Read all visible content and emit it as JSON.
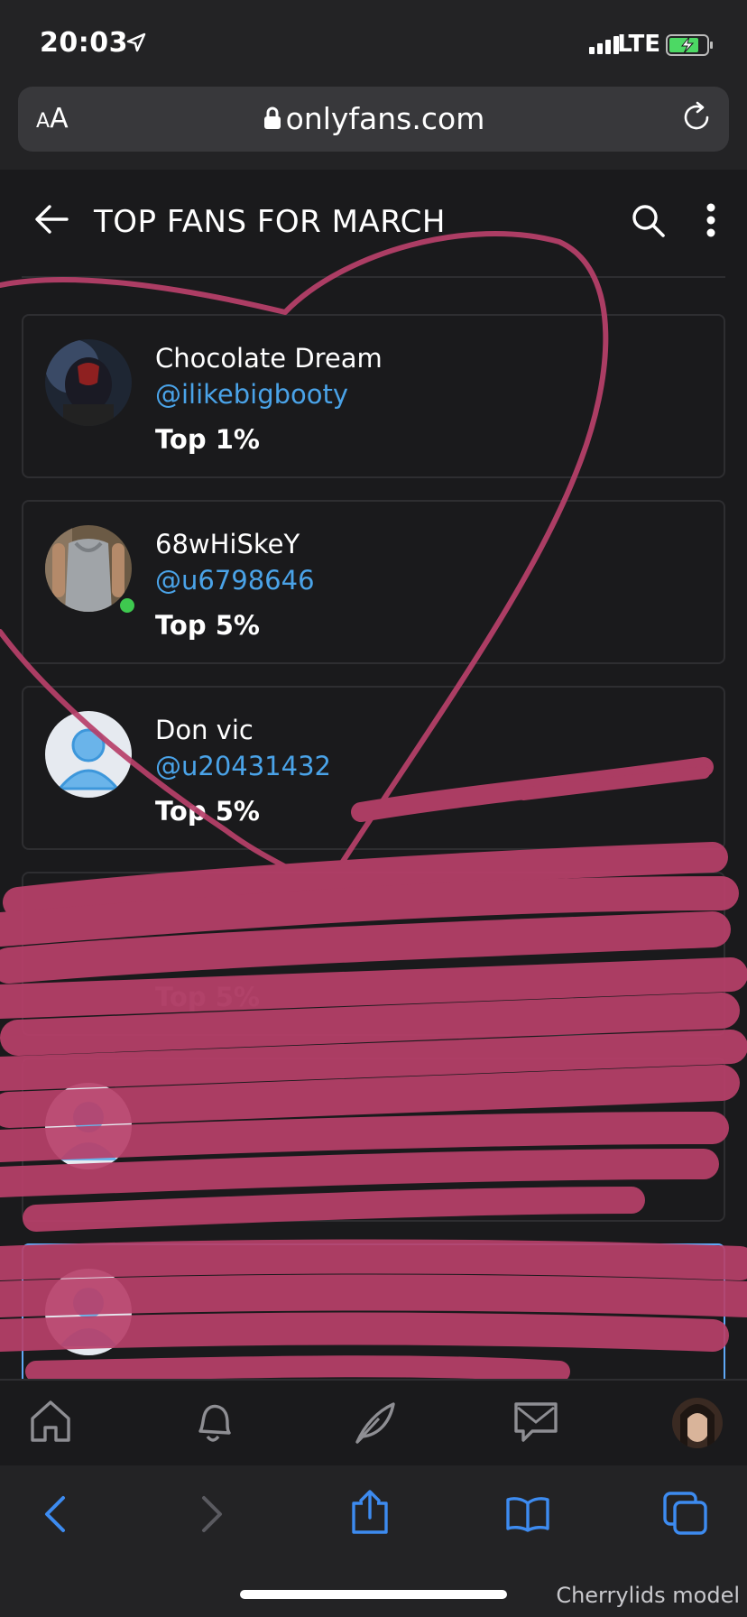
{
  "status_bar": {
    "time": "20:03",
    "network": "LTE",
    "location_icon": "location-arrow-icon",
    "battery_icon": "battery-charging-icon"
  },
  "browser": {
    "text_size_label": "AA",
    "url": "onlyfans.com",
    "lock_icon": "lock-icon",
    "reload_icon": "reload-icon"
  },
  "header": {
    "title": "TOP FANS FOR MARCH",
    "back_icon": "back-arrow-icon",
    "search_icon": "search-icon",
    "more_icon": "more-vertical-icon"
  },
  "fans": [
    {
      "name": "Chocolate Dream",
      "handle": "@ilikebigbooty",
      "rank": "Top 1%",
      "online": false
    },
    {
      "name": "68wHiSkeY",
      "handle": "@u6798646",
      "rank": "Top 5%",
      "online": true
    },
    {
      "name": "Don vic",
      "handle": "@u20431432",
      "rank": "Top 5%",
      "online": false
    },
    {
      "name": "",
      "handle": "",
      "rank": "Top 5%",
      "online": false
    },
    {
      "name": "",
      "handle": "",
      "rank": "",
      "online": false
    },
    {
      "name": "",
      "handle": "",
      "rank": "",
      "online": false
    }
  ],
  "app_nav": [
    "home-icon",
    "bell-icon",
    "feather-icon",
    "message-icon",
    "profile-avatar"
  ],
  "safari_toolbar": [
    "back-chevron-icon",
    "forward-chevron-icon",
    "share-icon",
    "bookmarks-icon",
    "tabs-icon"
  ],
  "watermark": "Cherrylids model",
  "colors": {
    "background": "#1a1a1c",
    "accent_blue": "#4aa3e8",
    "online_green": "#3ec94f",
    "scribble": "#b8406a"
  }
}
